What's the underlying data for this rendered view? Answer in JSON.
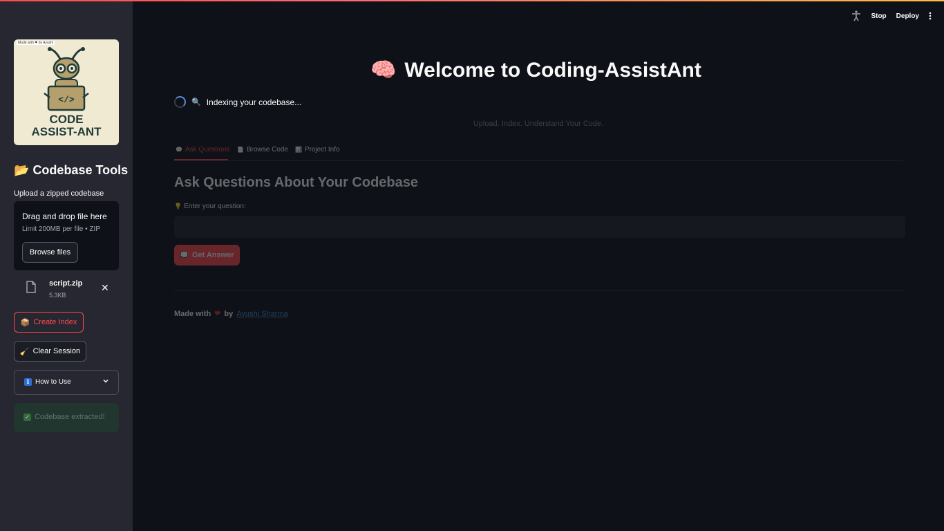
{
  "header": {
    "stop_label": "Stop",
    "deploy_label": "Deploy"
  },
  "sidebar": {
    "logo": {
      "tag": "Made with ❤ by Ayushi",
      "line1": "CODE",
      "line2": "ASSIST-ANT"
    },
    "title_icon": "📂",
    "title": "Codebase Tools",
    "upload_label": "Upload a zipped codebase",
    "dropzone": {
      "title": "Drag and drop file here",
      "subtitle": "Limit 200MB per file • ZIP",
      "browse_label": "Browse files"
    },
    "file": {
      "name": "script.zip",
      "size": "5.3KB"
    },
    "create_index_icon": "📦",
    "create_index_label": "Create Index",
    "clear_session_icon": "🧹",
    "clear_session_label": "Clear Session",
    "expander_icon": "ℹ",
    "expander_label": "How to Use",
    "success_check": "✓",
    "success_text": "Codebase extracted!"
  },
  "main": {
    "title_icon": "🧠",
    "title": "Welcome to Coding-AssistAnt",
    "spinner_icon": "🔍",
    "spinner_text": "Indexing your codebase...",
    "subtitle": "Upload. Index. Understand Your Code.",
    "tabs": [
      {
        "icon": "💬",
        "label": "Ask Questions"
      },
      {
        "icon": "📄",
        "label": "Browse Code"
      },
      {
        "icon": "📊",
        "label": "Project Info"
      }
    ],
    "section_title": "Ask Questions About Your Codebase",
    "question_icon": "💡",
    "question_label": "Enter your question:",
    "question_value": "",
    "get_answer_icon": "💭",
    "get_answer_label": "Get Answer",
    "footer_prefix": "Made with",
    "footer_heart": "❤",
    "footer_by": "by",
    "footer_author": "Ayushi Sharma"
  },
  "colors": {
    "primary": "#ff4b4b",
    "background": "#0e1117",
    "sidebar": "#262730",
    "link": "#4a8bd6"
  }
}
